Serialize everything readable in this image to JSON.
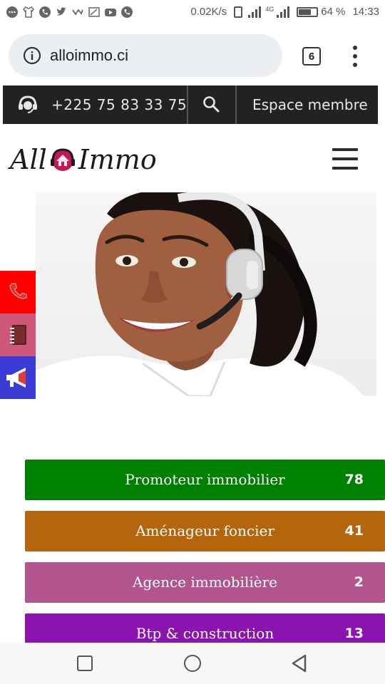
{
  "status_bar": {
    "speed": "0.02K/s",
    "network": "4G",
    "battery": "64 %",
    "battery_level": 0.64,
    "time": "14:33",
    "notification_icons": [
      "chat-icon",
      "shirt-icon",
      "phone-icon",
      "twitter-icon",
      "check-icon",
      "cast-icon",
      "youtube-icon",
      "phone-icon"
    ]
  },
  "browser": {
    "url": "alloimmo.ci",
    "tab_count": "6"
  },
  "topbar": {
    "phone": "+225 75 83 33 75",
    "member_label": "Espace membre"
  },
  "header": {
    "logo_left": "All",
    "logo_right": "Immo"
  },
  "side_buttons": [
    {
      "icon": "phone-icon",
      "color": "#ff0000"
    },
    {
      "icon": "notebook-icon",
      "color": "#ce5779"
    },
    {
      "icon": "megaphone-icon",
      "color": "#3b3bd6"
    }
  ],
  "categories": [
    {
      "label": "Promoteur immobilier",
      "count": "78",
      "color": "#008000"
    },
    {
      "label": "Aménageur foncier",
      "count": "41",
      "color": "#b5650d"
    },
    {
      "label": "Agence immobilière",
      "count": "2",
      "color": "#b2558e"
    },
    {
      "label": "Btp & construction",
      "count": "13",
      "color": "#8b14b0"
    }
  ]
}
